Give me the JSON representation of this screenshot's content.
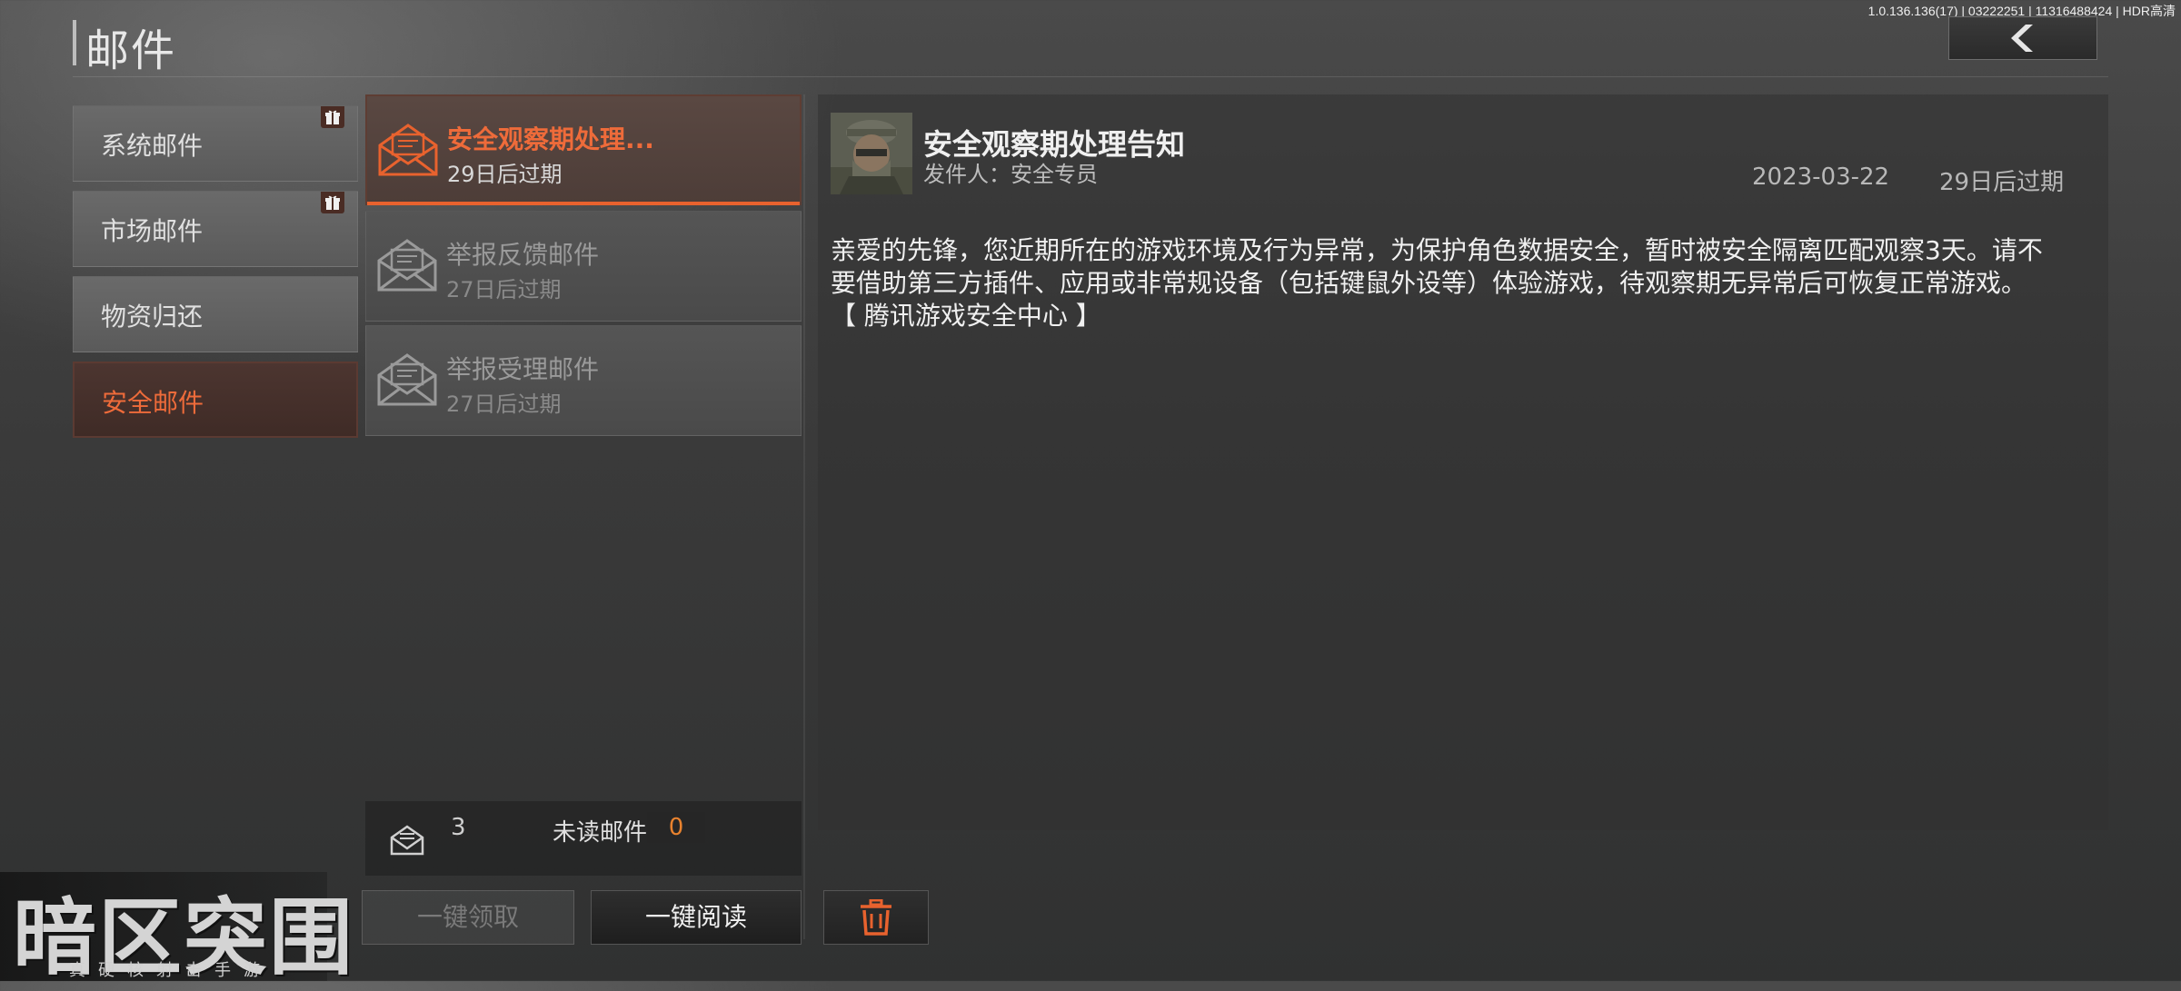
{
  "header": {
    "title": "邮件",
    "version": "1.0.136.136(17) | 03222251 | 11316488424 | HDR高清"
  },
  "tabs": [
    {
      "label": "系统邮件",
      "has_gift": true
    },
    {
      "label": "市场邮件",
      "has_gift": true
    },
    {
      "label": "物资归还",
      "has_gift": false
    },
    {
      "label": "安全邮件",
      "has_gift": false,
      "active": true
    }
  ],
  "mails": [
    {
      "subject": "安全观察期处理...",
      "expire": "29日后过期",
      "active": true
    },
    {
      "subject": "举报反馈邮件",
      "expire": "27日后过期"
    },
    {
      "subject": "举报受理邮件",
      "expire": "27日后过期"
    }
  ],
  "stats": {
    "count": "3",
    "unread_label": "未读邮件",
    "unread": "0"
  },
  "detail": {
    "title": "安全观察期处理告知",
    "sender": "发件人：安全专员",
    "date": "2023-03-22",
    "expire": "29日后过期",
    "body": [
      "亲爱的先锋，您近期所在的游戏环境及行为异常，为保护角色数据安全，暂时被安全隔离匹配观察3天。请不",
      "要借助第三方插件、应用或非常规设备（包括键鼠外设等）体验游戏，待观察期无异常后可恢复正常游戏。",
      "【 腾讯游戏安全中心 】"
    ]
  },
  "buttons": {
    "claim_all": "一键领取",
    "read_all": "一键阅读"
  },
  "logo": {
    "name": "暗区突围",
    "tagline": "真硬核射击手游"
  },
  "colors": {
    "accent": "#ee6b3a",
    "unread_count": "#e8822e"
  },
  "icons": {
    "back": "chevron-left-icon",
    "gift": "gift-icon",
    "mail": "envelope-open-icon",
    "delete": "trash-icon"
  }
}
